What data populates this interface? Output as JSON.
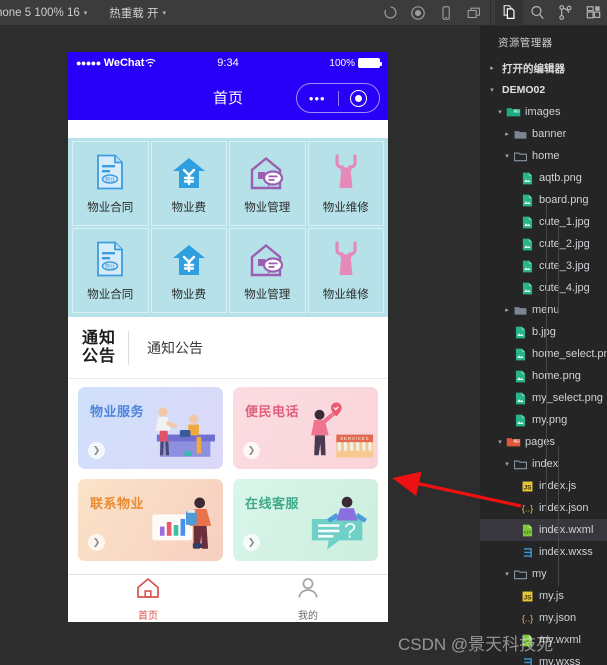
{
  "toolbar": {
    "device_label": "hone 5 100% 16",
    "hotreload_label": "热重载 开",
    "caret": "▾",
    "icons": [
      {
        "name": "refresh-icon",
        "title": "编译"
      },
      {
        "name": "stop-record-icon",
        "title": "录制"
      },
      {
        "name": "device-preview-icon",
        "title": "真机调试"
      },
      {
        "name": "detach-window-icon",
        "title": "切后台"
      },
      {
        "name": "explorer-icon",
        "title": "资源管理器"
      },
      {
        "name": "search-icon",
        "title": "搜索"
      },
      {
        "name": "source-control-icon",
        "title": "版本管理"
      },
      {
        "name": "extensions-icon",
        "title": "扩展"
      }
    ]
  },
  "sidebar": {
    "title": "资源管理器",
    "sections": [
      {
        "label": "打开的编辑器",
        "twisty": "▸"
      },
      {
        "label": "DEMO02",
        "twisty": "▾"
      }
    ],
    "tree": [
      {
        "label": "images",
        "indent": 2,
        "twisty": "▾",
        "icon": "folder-open-images",
        "type": "folder-special",
        "selected": false
      },
      {
        "label": "banner",
        "indent": 3,
        "twisty": "▸",
        "icon": "folder",
        "type": "folder",
        "selected": false
      },
      {
        "label": "home",
        "indent": 3,
        "twisty": "▾",
        "icon": "folder-open",
        "type": "folder",
        "selected": false
      },
      {
        "label": "aqtb.png",
        "indent": 4,
        "twisty": "",
        "icon": "image-file",
        "type": "image",
        "selected": false
      },
      {
        "label": "board.png",
        "indent": 4,
        "twisty": "",
        "icon": "image-file",
        "type": "image",
        "selected": false
      },
      {
        "label": "cute_1.jpg",
        "indent": 4,
        "twisty": "",
        "icon": "image-file",
        "type": "image",
        "selected": false
      },
      {
        "label": "cute_2.jpg",
        "indent": 4,
        "twisty": "",
        "icon": "image-file",
        "type": "image",
        "selected": false
      },
      {
        "label": "cute_3.jpg",
        "indent": 4,
        "twisty": "",
        "icon": "image-file",
        "type": "image",
        "selected": false
      },
      {
        "label": "cute_4.jpg",
        "indent": 4,
        "twisty": "",
        "icon": "image-file",
        "type": "image",
        "selected": false
      },
      {
        "label": "menu",
        "indent": 3,
        "twisty": "▸",
        "icon": "folder",
        "type": "folder",
        "selected": false
      },
      {
        "label": "b.jpg",
        "indent": 3,
        "twisty": "",
        "icon": "image-file",
        "type": "image",
        "selected": false
      },
      {
        "label": "home_select.png",
        "indent": 3,
        "twisty": "",
        "icon": "image-file",
        "type": "image",
        "selected": false
      },
      {
        "label": "home.png",
        "indent": 3,
        "twisty": "",
        "icon": "image-file",
        "type": "image",
        "selected": false
      },
      {
        "label": "my_select.png",
        "indent": 3,
        "twisty": "",
        "icon": "image-file",
        "type": "image",
        "selected": false
      },
      {
        "label": "my.png",
        "indent": 3,
        "twisty": "",
        "icon": "image-file",
        "type": "image",
        "selected": false
      },
      {
        "label": "pages",
        "indent": 2,
        "twisty": "▾",
        "icon": "folder-open-pages",
        "type": "folder-special",
        "selected": false
      },
      {
        "label": "index",
        "indent": 3,
        "twisty": "▾",
        "icon": "folder-open",
        "type": "folder",
        "selected": false
      },
      {
        "label": "index.js",
        "indent": 4,
        "twisty": "",
        "icon": "js-file",
        "type": "js",
        "selected": false
      },
      {
        "label": "index.json",
        "indent": 4,
        "twisty": "",
        "icon": "json-file",
        "type": "json",
        "selected": false
      },
      {
        "label": "index.wxml",
        "indent": 4,
        "twisty": "",
        "icon": "wxml-file",
        "type": "wxml",
        "selected": true
      },
      {
        "label": "index.wxss",
        "indent": 4,
        "twisty": "",
        "icon": "wxss-file",
        "type": "wxss",
        "selected": false
      },
      {
        "label": "my",
        "indent": 3,
        "twisty": "▾",
        "icon": "folder-open",
        "type": "folder",
        "selected": false
      },
      {
        "label": "my.js",
        "indent": 4,
        "twisty": "",
        "icon": "js-file",
        "type": "js",
        "selected": false
      },
      {
        "label": "my.json",
        "indent": 4,
        "twisty": "",
        "icon": "json-file",
        "type": "json",
        "selected": false
      },
      {
        "label": "my.wxml",
        "indent": 4,
        "twisty": "",
        "icon": "wxml-file",
        "type": "wxml",
        "selected": false
      },
      {
        "label": "my.wxss",
        "indent": 4,
        "twisty": "",
        "icon": "wxss-file",
        "type": "wxss",
        "selected": false
      }
    ]
  },
  "phone": {
    "status": {
      "dots": "●●●●●",
      "carrier": "WeChat",
      "wifi": "⌃",
      "time": "9:34",
      "battery_label": "100%"
    },
    "navbar": {
      "title": "首页",
      "capsule_dots": "•••"
    },
    "grid": [
      {
        "label": "物业合同",
        "icon": "contract-icon",
        "color": "#3d9ce0"
      },
      {
        "label": "物业费",
        "icon": "fee-house-icon",
        "color": "#2f9fe0"
      },
      {
        "label": "物业管理",
        "icon": "manage-house-icon",
        "color": "#9a5fb0"
      },
      {
        "label": "物业维修",
        "icon": "wrench-icon",
        "color": "#e58ab8"
      },
      {
        "label": "物业合同",
        "icon": "contract-icon",
        "color": "#3d9ce0"
      },
      {
        "label": "物业费",
        "icon": "fee-house-icon",
        "color": "#2f9fe0"
      },
      {
        "label": "物业管理",
        "icon": "manage-house-icon",
        "color": "#9a5fb0"
      },
      {
        "label": "物业维修",
        "icon": "wrench-icon",
        "color": "#e58ab8"
      }
    ],
    "notice": {
      "tag_line1": "通知",
      "tag_line2": "公告",
      "text": "通知公告"
    },
    "cards": [
      {
        "title": "物业服务",
        "title_color": "#4d86dd",
        "arrow": "❯",
        "art": "service-desk-illustration"
      },
      {
        "title": "便民电话",
        "title_color": "#e0607d",
        "arrow": "❯",
        "art": "services-store-illustration"
      },
      {
        "title": "联系物业",
        "title_color": "#e98b34",
        "arrow": "❯",
        "art": "chart-person-illustration"
      },
      {
        "title": "在线客服",
        "title_color": "#3fa98b",
        "arrow": "❯",
        "art": "support-chat-illustration"
      }
    ],
    "tabs": [
      {
        "label": "首页",
        "icon": "home-icon",
        "active": true,
        "color": "#d9534f"
      },
      {
        "label": "我的",
        "icon": "person-icon",
        "active": false,
        "color": "#9a9a9a"
      }
    ]
  },
  "annotation": {
    "arrow_color": "#ee1111"
  },
  "watermark": {
    "text": "CSDN @景天科技苑"
  }
}
